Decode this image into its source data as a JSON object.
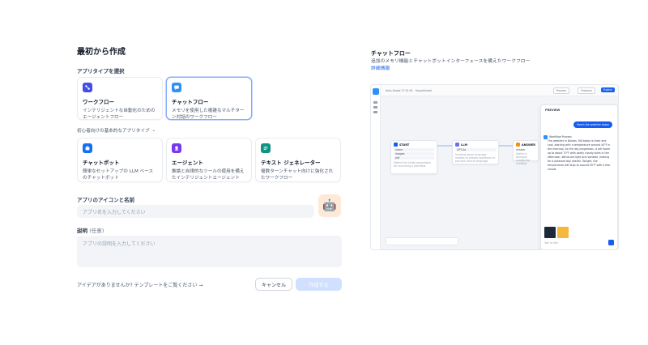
{
  "page": {
    "title": "最初から作成"
  },
  "app_type": {
    "label": "アプリタイプを選択",
    "primary": [
      {
        "title": "ワークフロー",
        "desc": "インテリジェントな自動化のためのエージェントフロー",
        "icon": "workflow-icon",
        "color": "#444ce7",
        "selected": false
      },
      {
        "title": "チャットフロー",
        "desc": "メモリを使用した複雑なマルチターン対話のワークフロー",
        "icon": "chatflow-icon",
        "color": "#2e90fa",
        "selected": true
      }
    ],
    "basic_toggle": "初心者向けの基本的なアプリタイプ",
    "basic": [
      {
        "title": "チャットボット",
        "desc": "簡単なセットアップの LLM ベースのチャットボット",
        "icon": "chatbot-icon",
        "color": "#1570ef"
      },
      {
        "title": "エージェント",
        "desc": "推論と自律的なツールの使用を備えたインテリジェントエージェント",
        "icon": "agent-icon",
        "color": "#7839ee"
      },
      {
        "title": "テキスト ジェネレーター",
        "desc": "複数ターンチャット向けに強化されたワークフロー",
        "icon": "text-generator-icon",
        "color": "#0e9384"
      }
    ]
  },
  "name_section": {
    "label": "アプリのアイコンと名前",
    "placeholder": "アプリ名を入力してください",
    "app_icon": "🤖",
    "app_icon_name": "robot-icon"
  },
  "description_section": {
    "label": "説明",
    "optional": "(任意)",
    "placeholder": "アプリの説明を入力してください"
  },
  "footer": {
    "idea_link": "アイデアがありませんか? テンプレートをご覧ください →",
    "cancel": "キャンセル",
    "create": "作成する"
  },
  "preview": {
    "title": "チャットフロー",
    "desc": "追加のメモリ機能とチャットボットインターフェースを備えたワークフロー",
    "more_link": "詳細情報",
    "canvas": {
      "topbar_title": "Auto-Saved 17:01:01 · Unpublished",
      "topbar_buttons": [
        "Preview",
        "Features",
        "Publish"
      ],
      "nodes": [
        {
          "title": "START",
          "lines": [
            "name",
            "images",
            "pdf"
          ],
          "foot": "Define the initial parameters for launching a workflow",
          "color": "#155eef"
        },
        {
          "title": "LLM",
          "lines": [
            "GPT-4o"
          ],
          "foot": "Invoking large language models to answer questions or process natural language",
          "color": "#6172f3"
        },
        {
          "title": "ANSWER",
          "lines": [
            "answer"
          ],
          "foot": "Define a dialogue context for chatflow",
          "color": "#f79009"
        }
      ],
      "chat": {
        "header": "PREVIEW",
        "user_msg": "How's the weather today",
        "bot_name": "Workflow Process",
        "bot_msg": "The weather in Boston, MA today is clear and cool, starting with a temperature around 44°F in the morning. As the day progresses, it will warm up to about 70°F with partly cloudy skies in the afternoon. Winds are light and variable, making for a pleasant day overall. Tonight, the temperature will drop to around 50°F with a few clouds.",
        "input_placeholder": "Talk to Bot"
      }
    }
  }
}
